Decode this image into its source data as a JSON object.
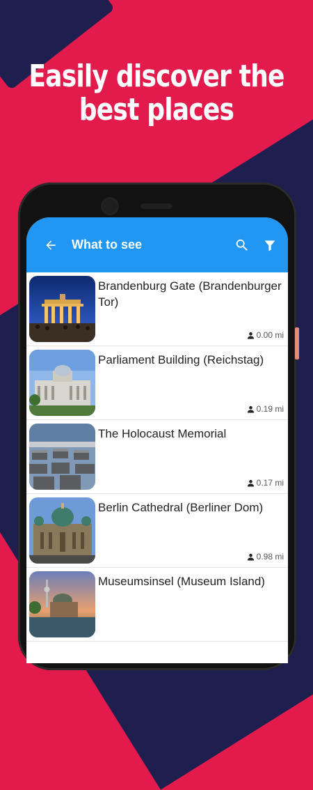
{
  "headline": {
    "line1": "Easily discover the",
    "line2": "best places"
  },
  "appbar": {
    "title": "What to see",
    "back_icon": "arrow-left",
    "search_icon": "search",
    "filter_icon": "filter"
  },
  "places": [
    {
      "name": "Brandenburg Gate (Brandenburger Tor)",
      "distance": "0.00 mi"
    },
    {
      "name": "Parliament Building (Reichstag)",
      "distance": "0.19 mi"
    },
    {
      "name": "The Holocaust Memorial",
      "distance": "0.17 mi"
    },
    {
      "name": "Berlin Cathedral (Berliner Dom)",
      "distance": "0.98 mi"
    },
    {
      "name": "Museumsinsel (Museum Island)",
      "distance": ""
    }
  ],
  "colors": {
    "background": "#e31b4d",
    "navy": "#1f1f4f",
    "appbar": "#2196f3"
  }
}
